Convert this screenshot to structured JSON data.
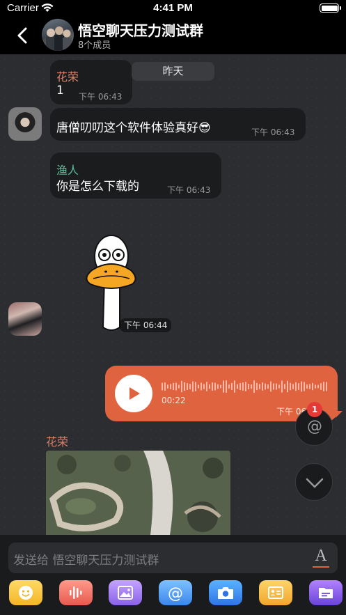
{
  "status_bar": {
    "carrier": "Carrier",
    "time": "4:41 PM"
  },
  "header": {
    "title": "悟空聊天压力测试群",
    "members": "8个成员",
    "back_icon": "chevron-left-icon"
  },
  "date_divider": "昨天",
  "messages": [
    {
      "sender": "花荣",
      "sender_color": "#d9826a",
      "text": "1",
      "time": "下午 06:43"
    },
    {
      "sender": "",
      "text": "唐僧叨叨这个软件体验真好😎",
      "time": "下午 06:43"
    },
    {
      "sender": "渔人",
      "sender_color": "#5fbf9a",
      "text": "你是怎么下载的",
      "time": "下午 06:43"
    },
    {
      "type": "sticker",
      "time": "下午 06:44"
    },
    {
      "type": "voice",
      "duration": "00:22",
      "time": "下午 06:44"
    },
    {
      "type": "image",
      "sender": "花荣"
    }
  ],
  "floating": {
    "mention_label": "@",
    "mention_badge": "1",
    "scroll_down_icon": "chevron-down-icon"
  },
  "input": {
    "placeholder": "发送给 悟空聊天压力测试群",
    "font_button": "A"
  },
  "toolbar": [
    {
      "icon": "emoji-icon"
    },
    {
      "icon": "voice-icon"
    },
    {
      "icon": "image-icon"
    },
    {
      "icon": "mention-icon",
      "label": "@"
    },
    {
      "icon": "camera-icon"
    },
    {
      "icon": "contact-card-icon"
    },
    {
      "icon": "file-icon"
    }
  ],
  "colors": {
    "accent": "#e0633f",
    "bubble": "#1b1c1e",
    "background": "#2b2d30"
  }
}
